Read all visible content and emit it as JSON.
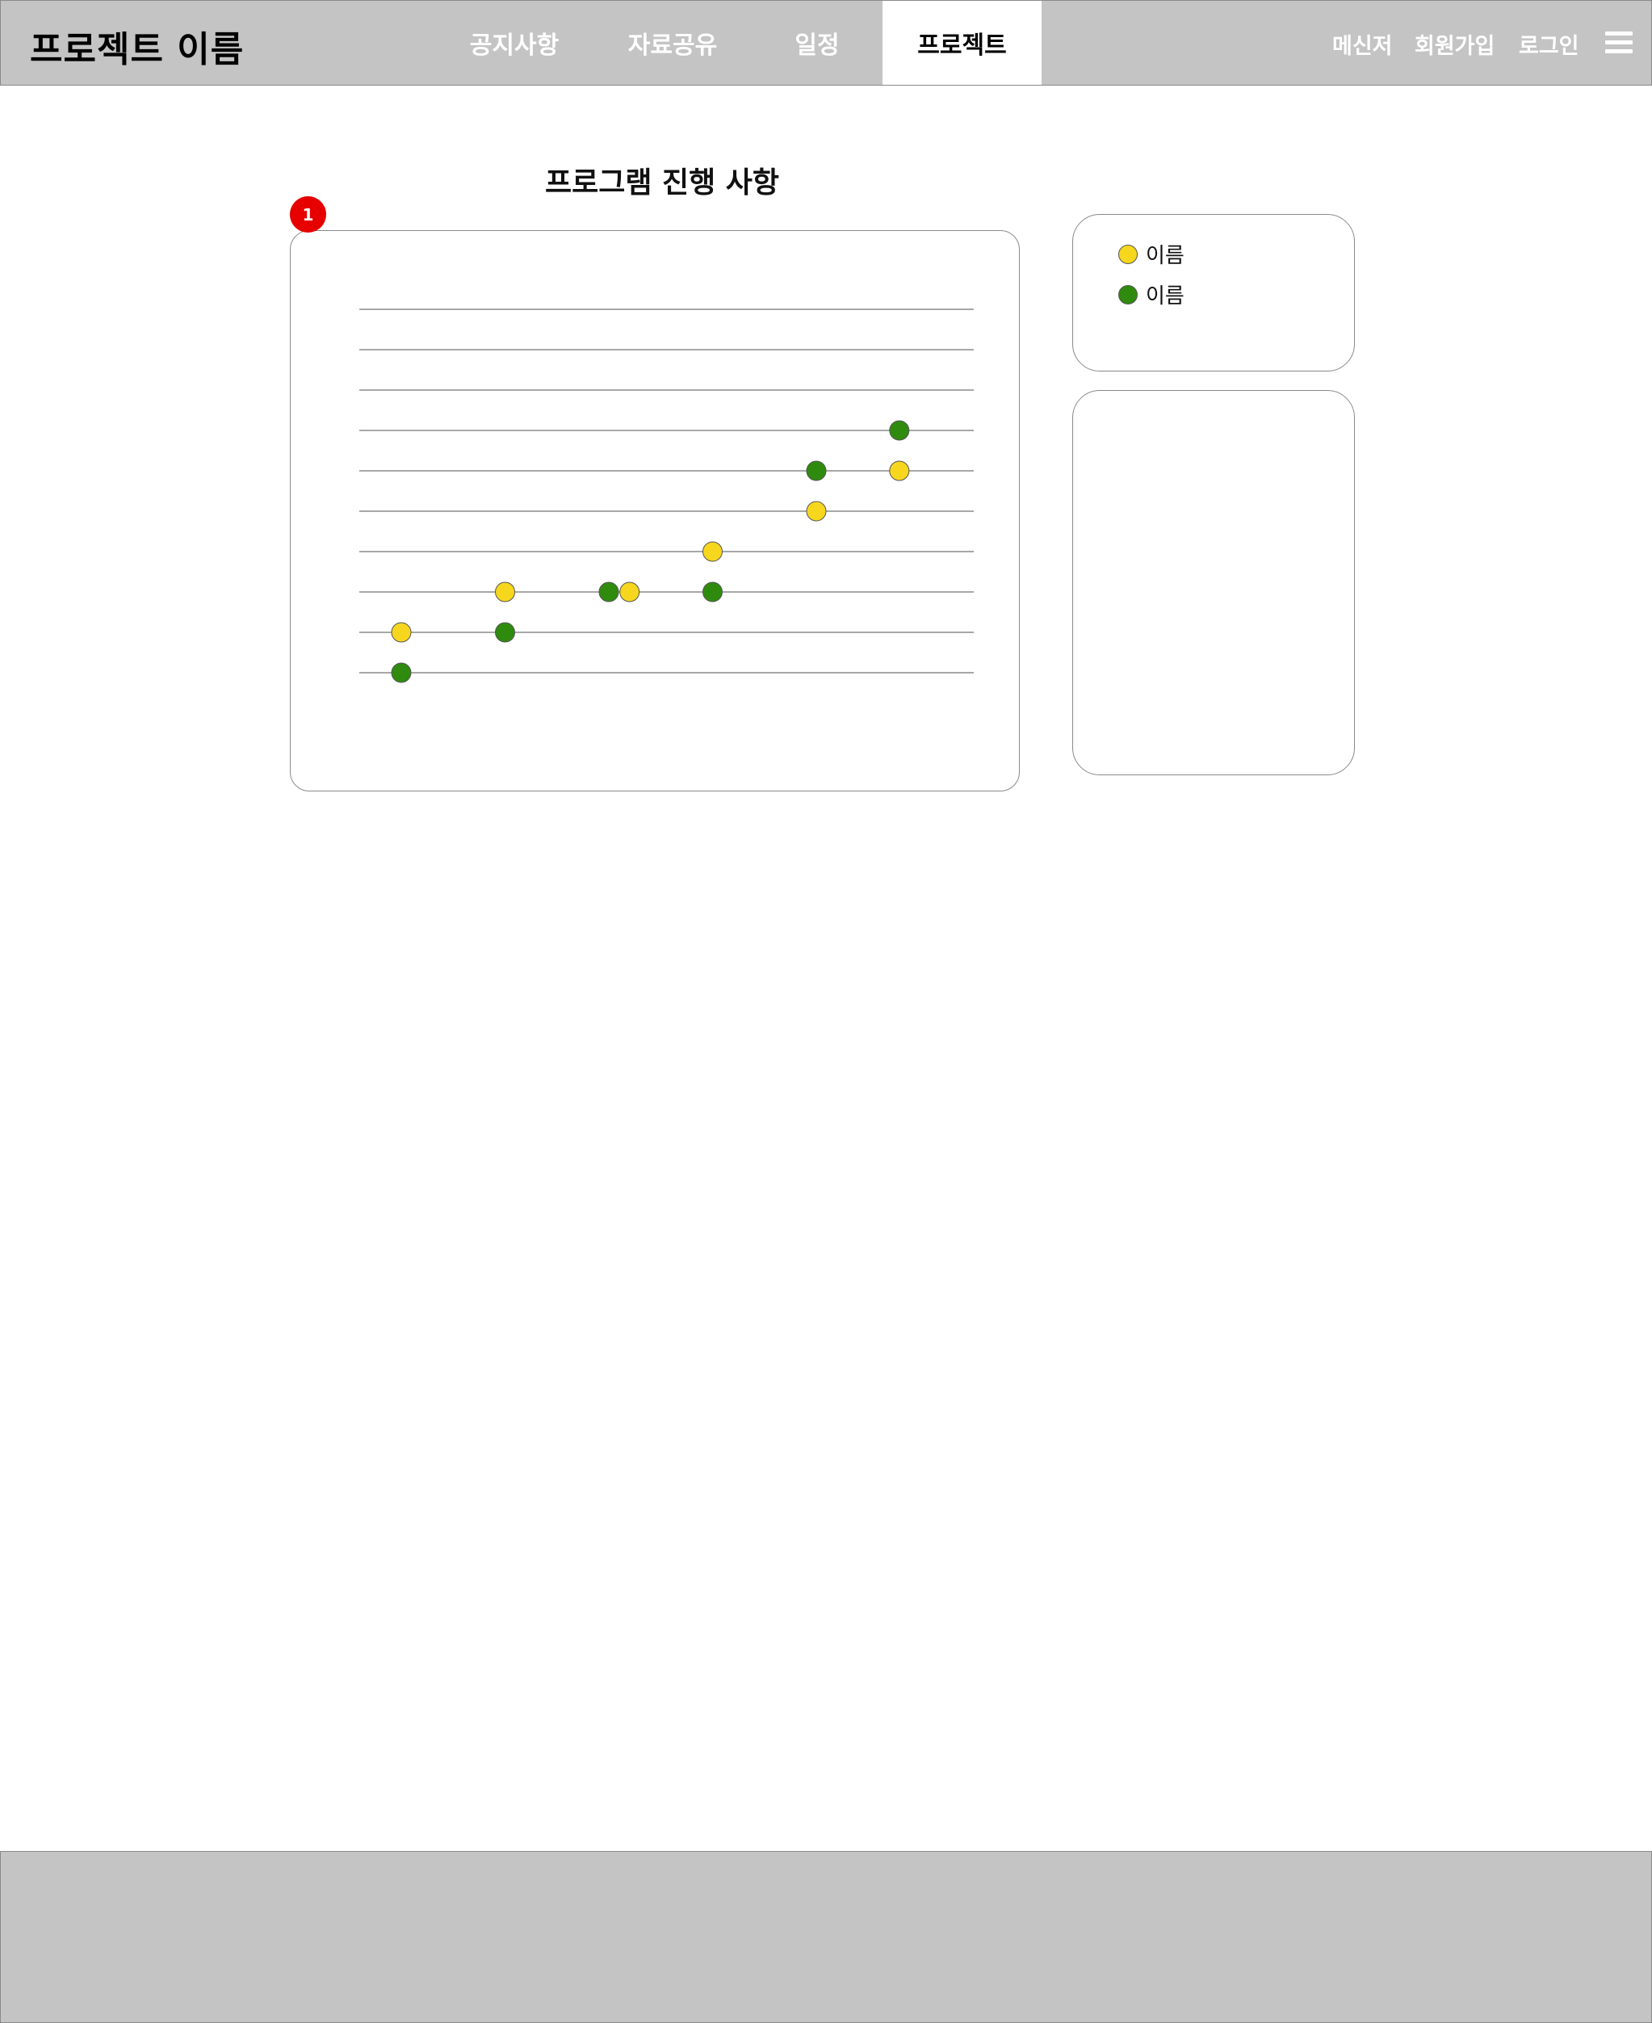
{
  "header": {
    "logo": "프로젝트 이름",
    "nav": [
      {
        "label": "공지사항",
        "active": false
      },
      {
        "label": "자료공유",
        "active": false
      },
      {
        "label": "일정",
        "active": false
      },
      {
        "label": "프로젝트",
        "active": true
      }
    ],
    "links": {
      "messenger": "메신저",
      "signup": "회원가입",
      "login": "로그인"
    },
    "menu_icon": "hamburger-menu-icon"
  },
  "main": {
    "title": "프로그램 진행 사항",
    "badge": "1"
  },
  "legend": [
    {
      "label": "이름",
      "color": "#f7d61e"
    },
    {
      "label": "이름",
      "color": "#2e8b0e"
    }
  ],
  "chart_data": {
    "type": "scatter",
    "grid": true,
    "rows": 10,
    "series": [
      {
        "name": "이름",
        "color": "#f7d61e",
        "points": [
          {
            "x": 1,
            "y": 2
          },
          {
            "x": 2,
            "y": 3
          },
          {
            "x": 3.2,
            "y": 3
          },
          {
            "x": 4,
            "y": 4
          },
          {
            "x": 5,
            "y": 5
          },
          {
            "x": 5.8,
            "y": 6
          }
        ]
      },
      {
        "name": "이름",
        "color": "#2e8b0e",
        "points": [
          {
            "x": 1,
            "y": 1
          },
          {
            "x": 2,
            "y": 2
          },
          {
            "x": 3,
            "y": 3
          },
          {
            "x": 4,
            "y": 3
          },
          {
            "x": 5,
            "y": 6
          },
          {
            "x": 5.8,
            "y": 7
          }
        ]
      }
    ]
  }
}
